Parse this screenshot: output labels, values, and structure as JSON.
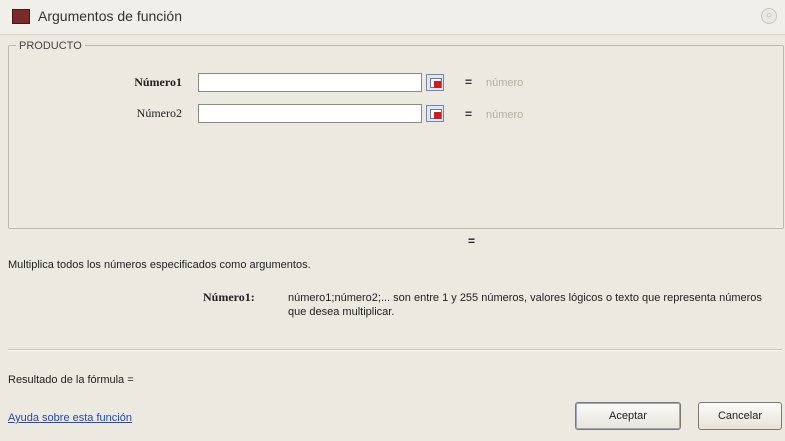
{
  "dialog": {
    "title": "Argumentos de función",
    "close_symbol": "○",
    "icon": "excel-function-icon"
  },
  "function_group": {
    "name": "PRODUCTO",
    "arguments": [
      {
        "label": "Número1",
        "value": "",
        "hint": "número",
        "bold": true
      },
      {
        "label": "Número2",
        "value": "",
        "hint": "número",
        "bold": false
      }
    ],
    "equals": "="
  },
  "result_preview_equals": "=",
  "description": "Multiplica todos los números especificados como argumentos.",
  "argument_help": {
    "name": "Número1:",
    "text": "número1;número2;... son entre 1 y 255 números, valores lógicos o texto que representa números que desea multiplicar."
  },
  "formula_result": {
    "label": "Resultado de la fórmula ="
  },
  "footer": {
    "help_link": "Ayuda sobre esta función",
    "ok_label": "Aceptar",
    "cancel_label": "Cancelar"
  }
}
